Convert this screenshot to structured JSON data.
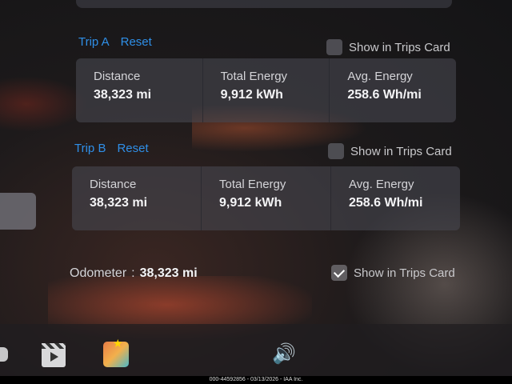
{
  "trip_a": {
    "name": "Trip A",
    "reset_label": "Reset",
    "show_in_trips_card": {
      "label": "Show in Trips Card",
      "checked": false
    },
    "stats": [
      {
        "label": "Distance",
        "value": "38,323 mi"
      },
      {
        "label": "Total Energy",
        "value": "9,912 kWh"
      },
      {
        "label": "Avg. Energy",
        "value": "258.6 Wh/mi"
      }
    ]
  },
  "trip_b": {
    "name": "Trip B",
    "reset_label": "Reset",
    "show_in_trips_card": {
      "label": "Show in Trips Card",
      "checked": false
    },
    "stats": [
      {
        "label": "Distance",
        "value": "38,323 mi"
      },
      {
        "label": "Total Energy",
        "value": "9,912 kWh"
      },
      {
        "label": "Avg. Energy",
        "value": "258.6 Wh/mi"
      }
    ]
  },
  "odometer": {
    "label": "Odometer",
    "separator": ":",
    "value": "38,323 mi",
    "show_in_trips_card": {
      "label": "Show in Trips Card",
      "checked": true
    }
  },
  "dock": {
    "icons": [
      "partial-app-icon",
      "theater-icon",
      "arcade-icon",
      "volume-icon"
    ]
  },
  "footer": {
    "text": "000-44592856 - 03/13/2026 - IAA Inc."
  },
  "colors": {
    "accent": "#2f8fe8",
    "card": "#484850",
    "text": "#f4f4f6"
  }
}
